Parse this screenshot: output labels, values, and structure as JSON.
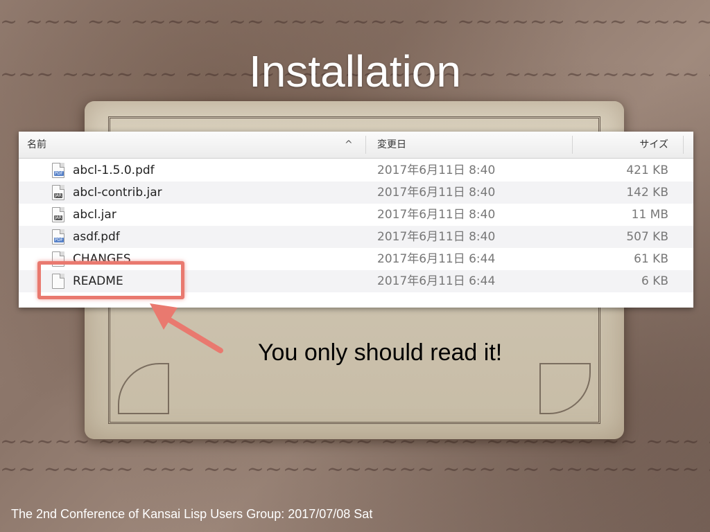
{
  "slide": {
    "title": "Installation",
    "callout": "You only should read it!",
    "footer": "The 2nd Conference of Kansai Lisp Users Group: 2017/07/08 Sat"
  },
  "finder": {
    "columns": {
      "name": "名前",
      "date": "変更日",
      "size": "サイズ"
    },
    "sort_indicator": "^",
    "files": [
      {
        "name": "abcl-1.5.0.pdf",
        "date": "2017年6月11日 8:40",
        "size": "421 KB",
        "icon": "pdf-file-icon"
      },
      {
        "name": "abcl-contrib.jar",
        "date": "2017年6月11日 8:40",
        "size": "142 KB",
        "icon": "jar-file-icon"
      },
      {
        "name": "abcl.jar",
        "date": "2017年6月11日 8:40",
        "size": "11 MB",
        "icon": "jar-file-icon"
      },
      {
        "name": "asdf.pdf",
        "date": "2017年6月11日 8:40",
        "size": "507 KB",
        "icon": "pdf-file-icon"
      },
      {
        "name": "CHANGES",
        "date": "2017年6月11日 6:44",
        "size": "61 KB",
        "icon": "document-file-icon"
      },
      {
        "name": "README",
        "date": "2017年6月11日 6:44",
        "size": "6 KB",
        "icon": "document-file-icon"
      }
    ],
    "icon_tags": {
      "pdf": "PDF",
      "jar": "JAR"
    }
  },
  "colors": {
    "highlight": "#e9796f",
    "title": "#ffffff"
  }
}
